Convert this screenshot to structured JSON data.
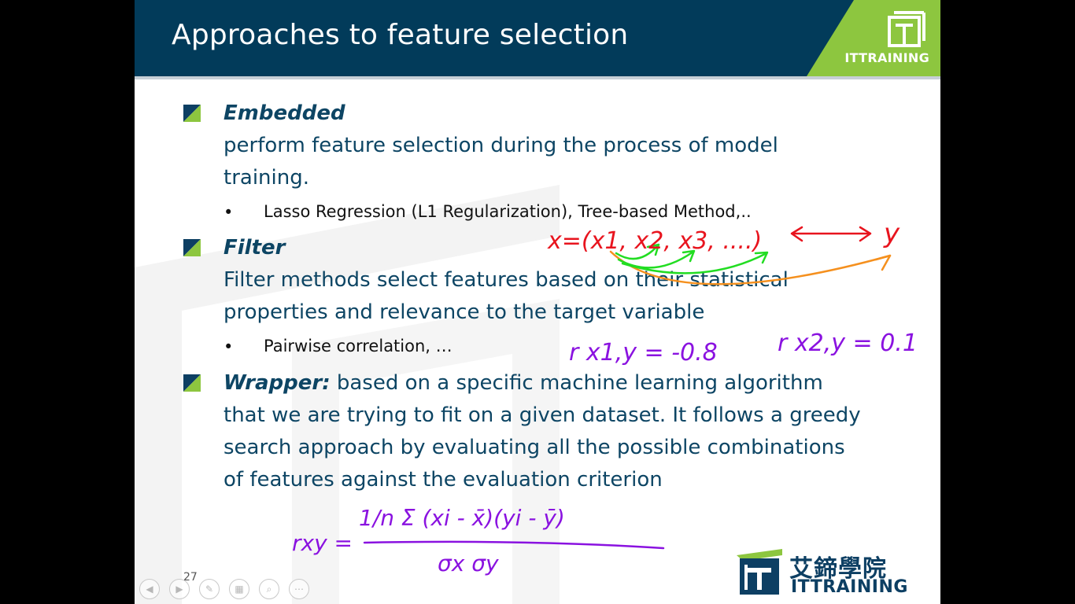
{
  "slide": {
    "title": "Approaches to feature selection",
    "corner_logo_text": "ITTRAINING",
    "page_number": "27",
    "bottom_logo": {
      "chinese": "艾鍗學院",
      "english": "ITTRAINING"
    }
  },
  "bullets": [
    {
      "term": "Embedded",
      "lines": [
        "perform feature selection during the process of model",
        "training."
      ],
      "sub": "Lasso Regression (L1 Regularization), Tree-based Method,.."
    },
    {
      "term": "Filter",
      "lines": [
        "Filter methods select features based on their statistical",
        "properties and relevance to the target variable"
      ],
      "sub": "Pairwise correlation, …"
    },
    {
      "term": "Wrapper:",
      "first_line_rest": " based on a specific machine learning algorithm",
      "lines": [
        "that we are trying to fit on a given dataset. It follows a greedy",
        "search approach by evaluating all the possible combinations",
        "of features against the evaluation criterion"
      ]
    }
  ],
  "annotations": {
    "vector": "x=(x1, x2, x3, ....)",
    "target": "y",
    "corr1": "r x1,y = -0.8",
    "corr2": "r x2,y = 0.1",
    "formula_lhs": "rxy =",
    "formula_numerator": "1/n Σ (xi - x̄)(yi - ȳ)",
    "formula_denominator": "σx σy"
  },
  "controls": [
    "prev-icon",
    "next-icon",
    "pen-icon",
    "slides-icon",
    "zoom-icon",
    "more-icon"
  ],
  "colors": {
    "header": "#023b5a",
    "text": "#0d4564",
    "accent_green": "#8dc63f",
    "ink_red": "#e8141e",
    "ink_green": "#22dd22",
    "ink_orange": "#f5901e",
    "ink_purple": "#8a12e0"
  }
}
